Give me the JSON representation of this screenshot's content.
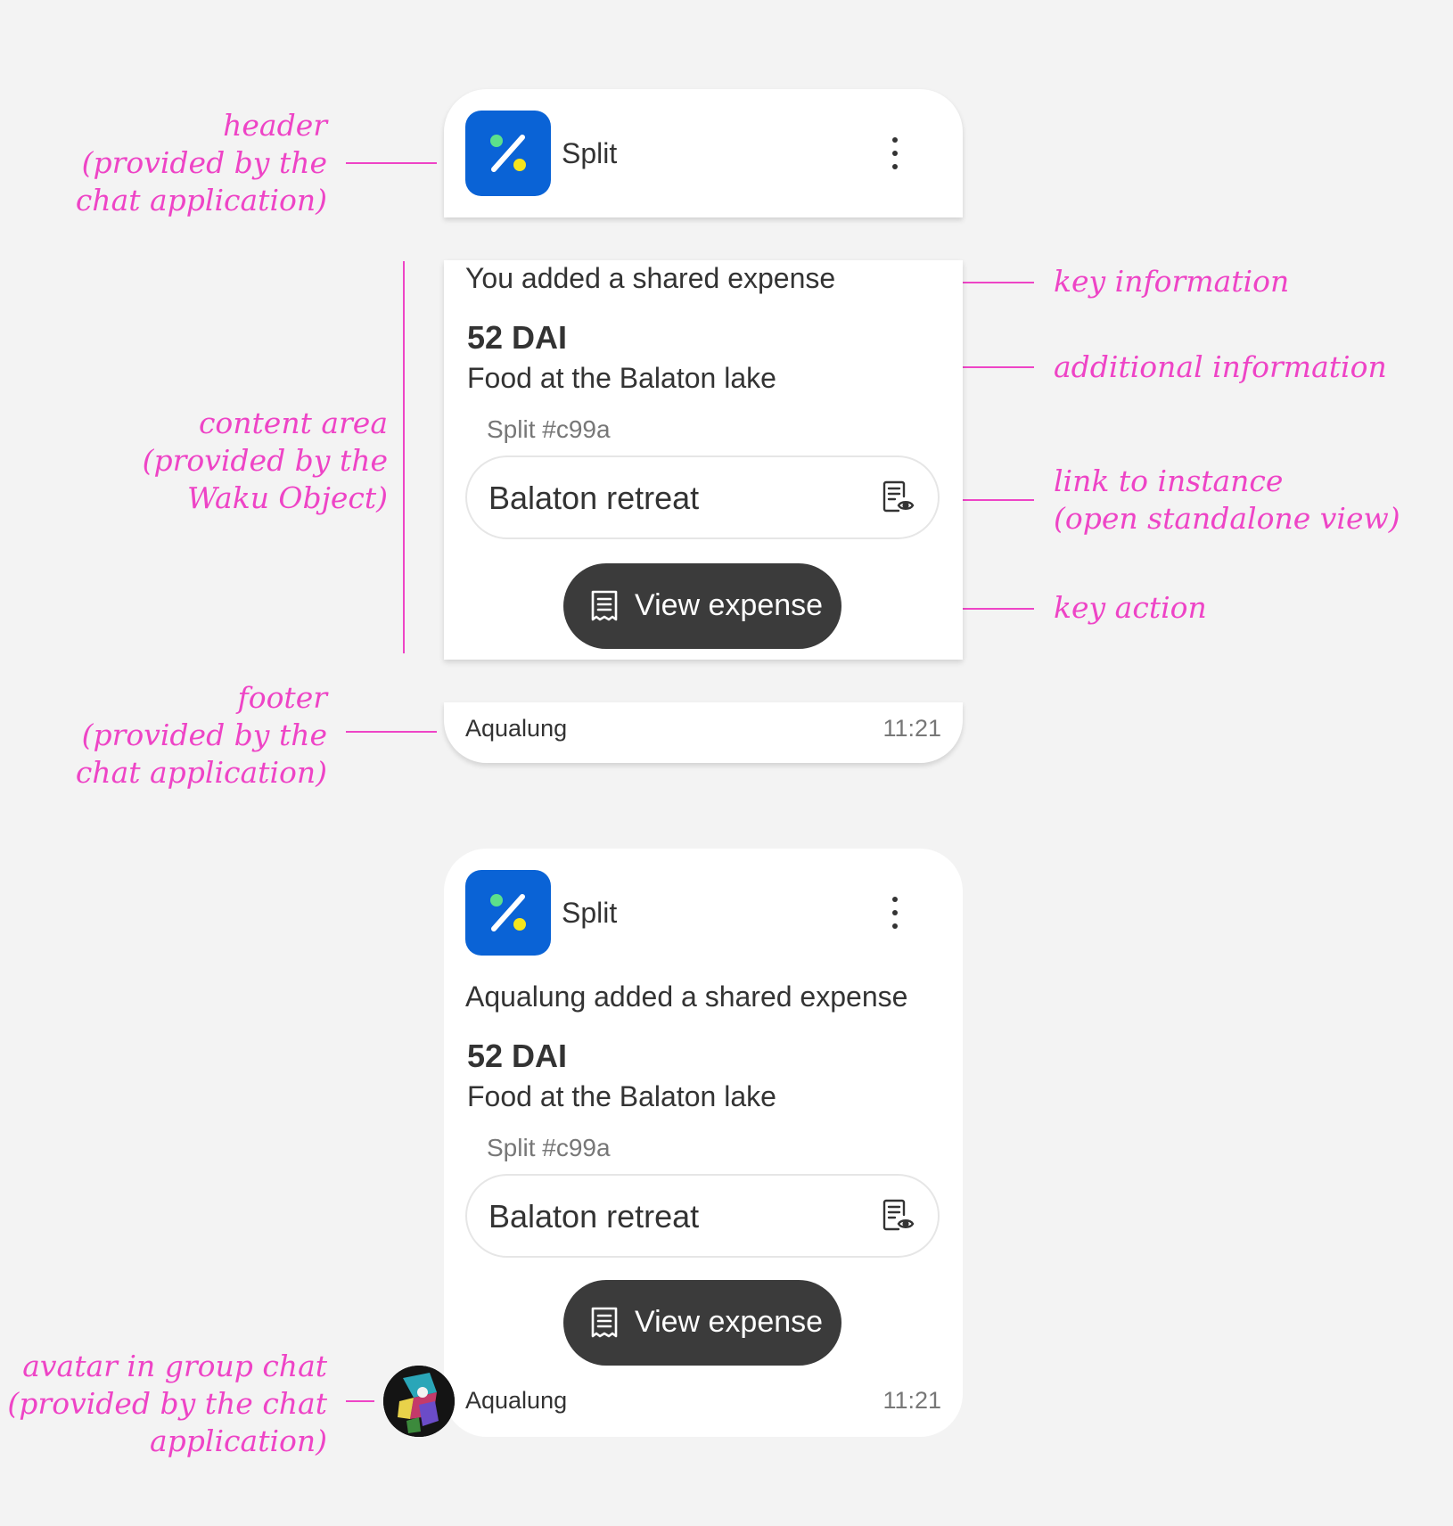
{
  "annotations": {
    "header": [
      "header",
      "(provided by the",
      "chat application)"
    ],
    "content_area": [
      "content area",
      "(provided by the",
      "Waku Object)"
    ],
    "footer": [
      "footer",
      "(provided by the",
      "chat application)"
    ],
    "key_information": [
      "key information"
    ],
    "additional_information": [
      "additional information"
    ],
    "link_to_instance": [
      "link to instance",
      "(open standalone view)"
    ],
    "key_action": [
      "key action"
    ],
    "avatar": [
      "avatar in group chat",
      "(provided by the chat",
      "application)"
    ]
  },
  "colors": {
    "annotation": "#ee44c6",
    "app_icon_bg": "#0a63d6",
    "button_bg": "#3b3b3b",
    "background": "#f3f3f3"
  },
  "exploded_card": {
    "header": {
      "app_name": "Split",
      "icon": "percent-app-icon",
      "menu_icon": "more-vertical-icon"
    },
    "content": {
      "key_text": "You added a shared expense",
      "amount": "52 DAI",
      "description": "Food at the Balaton lake",
      "instance_id": "Split #c99a",
      "instance_name": "Balaton retreat",
      "instance_icon": "document-view-icon",
      "action_label": "View expense",
      "action_icon": "receipt-icon"
    },
    "footer": {
      "sender": "Aqualung",
      "time": "11:21"
    }
  },
  "group_card": {
    "header": {
      "app_name": "Split",
      "icon": "percent-app-icon",
      "menu_icon": "more-vertical-icon"
    },
    "content": {
      "key_text": "Aqualung added a shared expense",
      "amount": "52 DAI",
      "description": "Food at the Balaton lake",
      "instance_id": "Split #c99a",
      "instance_name": "Balaton retreat",
      "instance_icon": "document-view-icon",
      "action_label": "View expense",
      "action_icon": "receipt-icon"
    },
    "footer": {
      "sender": "Aqualung",
      "time": "11:21",
      "avatar": "user-avatar"
    }
  }
}
